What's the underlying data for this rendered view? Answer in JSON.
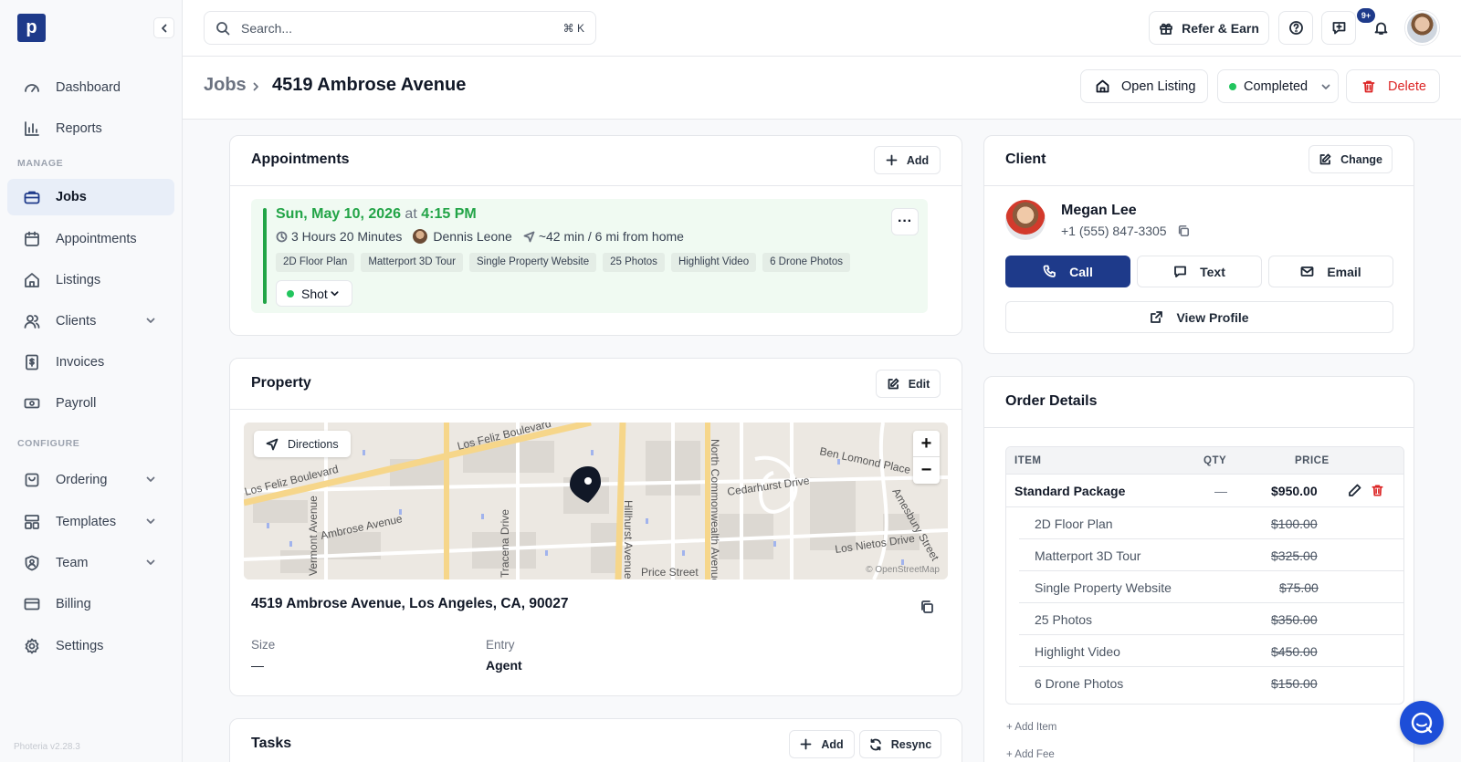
{
  "app": {
    "logo_letter": "p",
    "version": "Photeria v2.28.3"
  },
  "sidebar": {
    "items": [
      {
        "label": "Dashboard"
      },
      {
        "label": "Reports"
      },
      {
        "label": "Jobs"
      },
      {
        "label": "Appointments"
      },
      {
        "label": "Listings"
      },
      {
        "label": "Clients"
      },
      {
        "label": "Invoices"
      },
      {
        "label": "Payroll"
      },
      {
        "label": "Ordering"
      },
      {
        "label": "Templates"
      },
      {
        "label": "Team"
      },
      {
        "label": "Billing"
      },
      {
        "label": "Settings"
      }
    ],
    "section_manage": "MANAGE",
    "section_configure": "CONFIGURE"
  },
  "topbar": {
    "search_placeholder": "Search...",
    "search_shortcut": "⌘ K",
    "refer_label": "Refer & Earn",
    "notif_badge": "9+"
  },
  "header": {
    "crumb_parent": "Jobs",
    "crumb_title": "4519 Ambrose Avenue",
    "open_listing": "Open Listing",
    "status": "Completed",
    "delete": "Delete"
  },
  "appointments": {
    "title": "Appointments",
    "add_label": "Add",
    "date": "Sun, May 10, 2026",
    "at": "at",
    "time": "4:15 PM",
    "duration": "3 Hours 20 Minutes",
    "photographer": "Dennis Leone",
    "distance": "~42 min / 6 mi from home",
    "services": [
      "2D Floor Plan",
      "Matterport 3D Tour",
      "Single Property Website",
      "25 Photos",
      "Highlight Video",
      "6 Drone Photos"
    ],
    "status": "Shot",
    "more": "···"
  },
  "property": {
    "title": "Property",
    "edit_label": "Edit",
    "directions": "Directions",
    "map_labels": {
      "road1": "Los Feliz Boulevard",
      "road2": "Los Feliz Boulevard",
      "road3": "Ambrose Avenue",
      "road4": "Hillhurst Avenue",
      "road5": "North Commonwealth Avenue",
      "road6": "Vermont Avenue",
      "road7": "Price Street",
      "road8": "Cedarhurst Drive",
      "road9": "Ben Lomond Place",
      "road10": "Los Nietos Drive",
      "road11": "Amesbury Street",
      "road12": "Tracena Drive",
      "attribution": "© OpenStreetMap"
    },
    "zoom_in": "+",
    "zoom_out": "−",
    "address": "4519 Ambrose Avenue, Los Angeles, CA, 90027",
    "size_label": "Size",
    "size_value": "—",
    "entry_label": "Entry",
    "entry_value": "Agent"
  },
  "tasks": {
    "title": "Tasks",
    "add_label": "Add",
    "resync_label": "Resync"
  },
  "client": {
    "title": "Client",
    "change_label": "Change",
    "name": "Megan Lee",
    "phone": "+1 (555) 847-3305",
    "call": "Call",
    "text": "Text",
    "email": "Email",
    "view_profile": "View Profile"
  },
  "order": {
    "title": "Order Details",
    "col_item": "ITEM",
    "col_qty": "QTY",
    "col_price": "PRICE",
    "package": {
      "name": "Standard Package",
      "qty": "—",
      "price": "$950.00"
    },
    "items": [
      {
        "name": "2D Floor Plan",
        "price": "$100.00"
      },
      {
        "name": "Matterport 3D Tour",
        "price": "$325.00"
      },
      {
        "name": "Single Property Website",
        "price": "$75.00"
      },
      {
        "name": "25 Photos",
        "price": "$350.00"
      },
      {
        "name": "Highlight Video",
        "price": "$450.00"
      },
      {
        "name": "6 Drone Photos",
        "price": "$150.00"
      }
    ],
    "add_item": "+ Add Item",
    "add_fee": "+ Add Fee"
  },
  "colors": {
    "brand": "#1e3a8a",
    "success": "#22a447",
    "danger": "#dc2626"
  }
}
